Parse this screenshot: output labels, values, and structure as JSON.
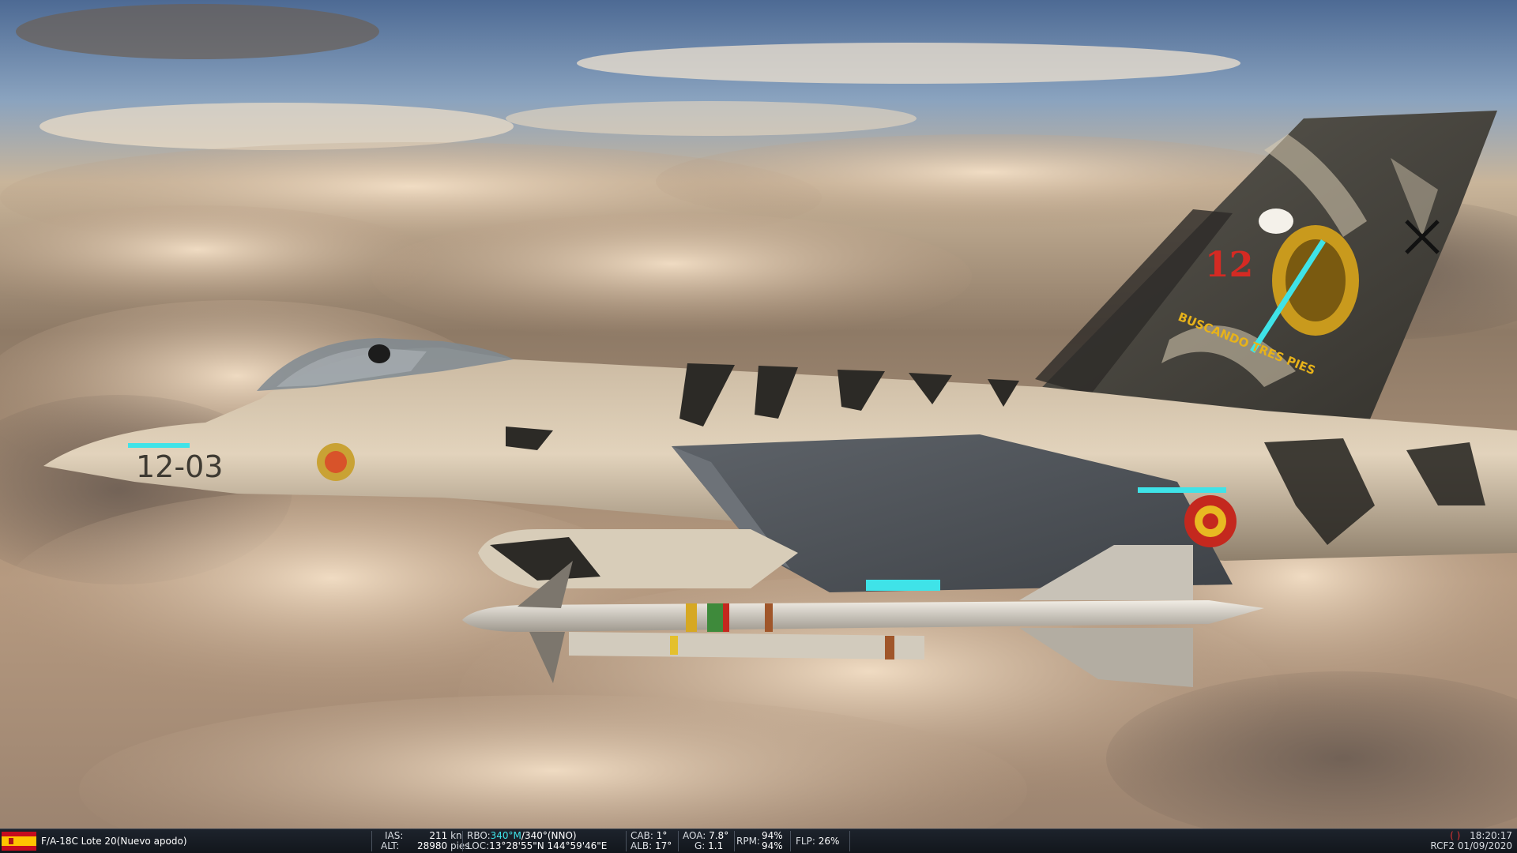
{
  "aircraft": {
    "name": "F/A-18C Lote 20(Nuevo apodo)",
    "tail_number": "12-03",
    "tail_motto": "BUSCANDO TRES PIES",
    "tail_code": "12"
  },
  "flight": {
    "ias_label": "IAS:",
    "ias_value": "211",
    "ias_unit": "kn",
    "alt_label": "ALT:",
    "alt_value": "28980",
    "alt_unit": "pies",
    "rbo_label": "RBO:",
    "rbo_mag": "340°M",
    "rbo_true": "/340°(NNO)",
    "loc_label": "LOC:",
    "loc_value": "13°28'55\"N 144°59'46\"E",
    "cab_label": "CAB:",
    "cab_value": "1°",
    "alb_label": "ALB:",
    "alb_value": "17°",
    "aoa_label": "AOA:",
    "aoa_value": "7.8°",
    "g_label": "G:",
    "g_value": "1.1",
    "rpm_label": "RPM:",
    "rpm_1": "94%",
    "rpm_2": "94%",
    "flp_label": "FLP:",
    "flp_value": "26%"
  },
  "clock": {
    "time": "18:20:17",
    "callsign_date": "RCF2 01/09/2020",
    "record_indicator": "( )"
  },
  "icons": {
    "flag": "spain-flag-icon"
  },
  "colors": {
    "highlight": "#3fe3e8",
    "statusbar_bg": "#161b22"
  }
}
